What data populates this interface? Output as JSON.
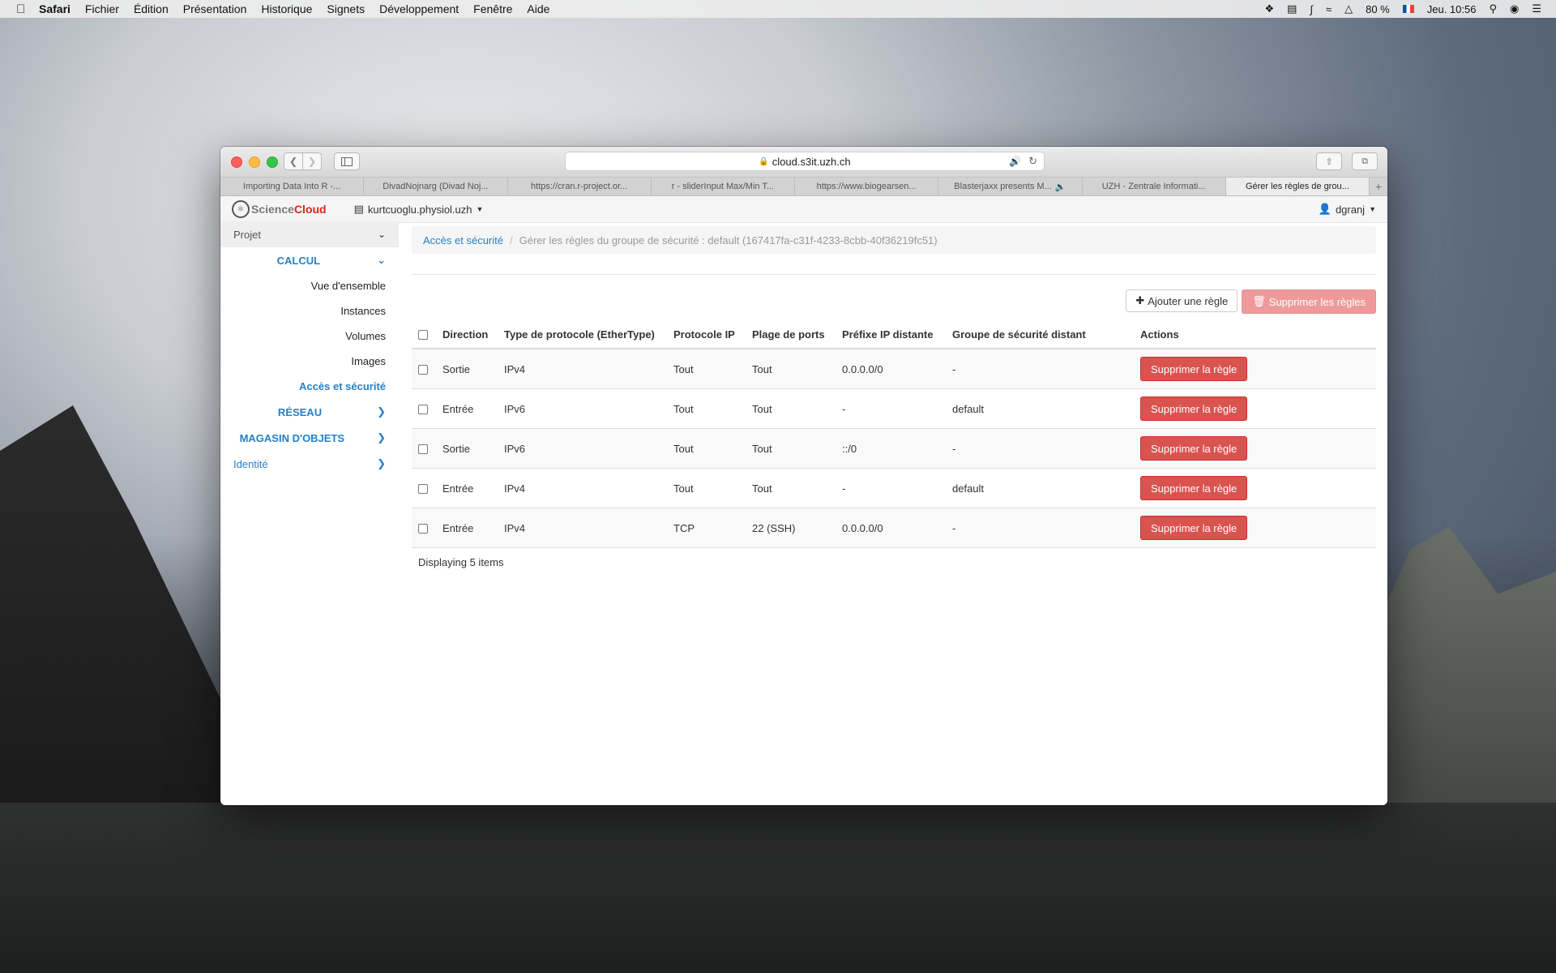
{
  "menubar": {
    "app": "Safari",
    "items": [
      "Fichier",
      "Édition",
      "Présentation",
      "Historique",
      "Signets",
      "Développement",
      "Fenêtre",
      "Aide"
    ],
    "battery": "80 %",
    "clock": "Jeu. 10:56"
  },
  "browser": {
    "url": "cloud.s3it.uzh.ch",
    "tabs": [
      "Importing Data Into R -...",
      "DivadNojnarg (Divad Noj...",
      "https://cran.r-project.or...",
      "r - sliderInput Max/Min T...",
      "https://www.biogearsen...",
      "Blasterjaxx presents M...",
      "UZH - Zentrale Informati...",
      "Gérer les règles de grou..."
    ]
  },
  "header": {
    "logo_left": "Science",
    "logo_right": "Cloud",
    "project": "kurtcuoglu.physiol.uzh",
    "user": "dgranj"
  },
  "sidebar": {
    "project_label": "Projet",
    "calc_label": "CALCUL",
    "calc_items": [
      "Vue d'ensemble",
      "Instances",
      "Volumes",
      "Images",
      "Accès et sécurité"
    ],
    "network_label": "RÉSEAU",
    "object_store_label": "MAGASIN D'OBJETS",
    "identity_label": "Identité"
  },
  "breadcrumb": {
    "link": "Accès et sécurité",
    "current": "Gérer les règles du groupe de sécurité : default (167417fa-c31f-4233-8cbb-40f36219fc51)"
  },
  "toolbar": {
    "add_rule": "Ajouter une règle",
    "delete_rules": "Supprimer les règles"
  },
  "table": {
    "headers": [
      "Direction",
      "Type de protocole (EtherType)",
      "Protocole IP",
      "Plage de ports",
      "Préfixe IP distante",
      "Groupe de sécurité distant",
      "Actions"
    ],
    "rows": [
      {
        "direction": "Sortie",
        "ethertype": "IPv4",
        "protocol": "Tout",
        "ports": "Tout",
        "prefix": "0.0.0.0/0",
        "group": "-",
        "action": "Supprimer la règle"
      },
      {
        "direction": "Entrée",
        "ethertype": "IPv6",
        "protocol": "Tout",
        "ports": "Tout",
        "prefix": "-",
        "group": "default",
        "action": "Supprimer la règle"
      },
      {
        "direction": "Sortie",
        "ethertype": "IPv6",
        "protocol": "Tout",
        "ports": "Tout",
        "prefix": "::/0",
        "group": "-",
        "action": "Supprimer la règle"
      },
      {
        "direction": "Entrée",
        "ethertype": "IPv4",
        "protocol": "Tout",
        "ports": "Tout",
        "prefix": "-",
        "group": "default",
        "action": "Supprimer la règle"
      },
      {
        "direction": "Entrée",
        "ethertype": "IPv4",
        "protocol": "TCP",
        "ports": "22 (SSH)",
        "prefix": "0.0.0.0/0",
        "group": "-",
        "action": "Supprimer la règle"
      }
    ],
    "footer": "Displaying 5 items"
  }
}
